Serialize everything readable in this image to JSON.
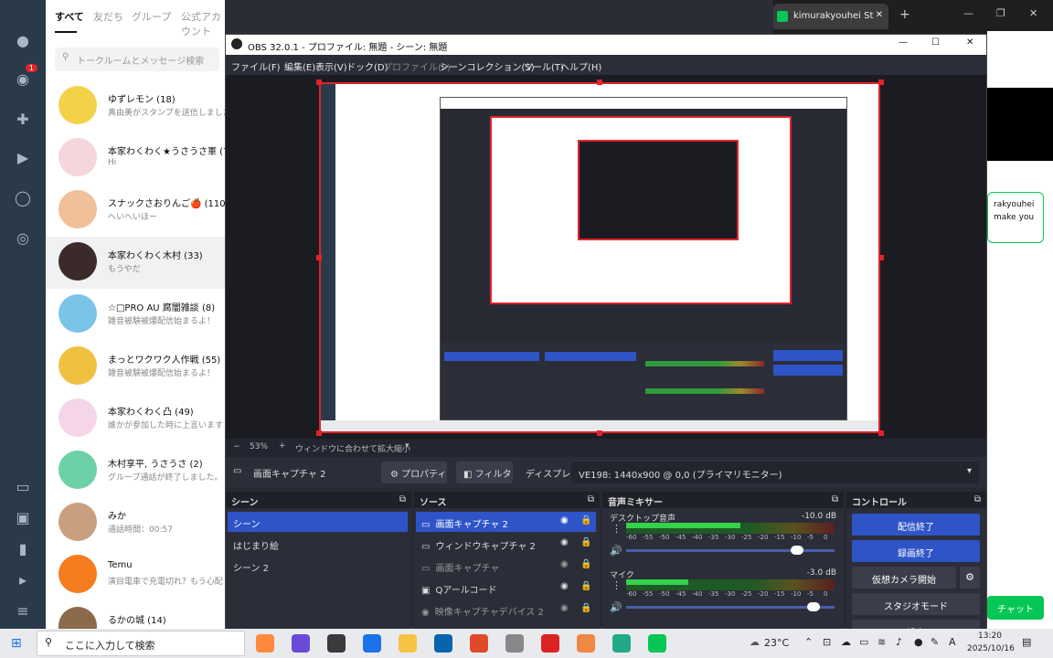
{
  "line": {
    "tabs": [
      "すべて",
      "友だち",
      "グループ",
      "公式アカウント"
    ],
    "search_placeholder": "トークルームとメッセージ検索",
    "rail_badge": "1",
    "chats": [
      {
        "name": "ゆずレモン (18)",
        "msg": "真由美がスタンプを送信しました。"
      },
      {
        "name": "本家わくわく★うさうさ軍 (79)",
        "msg": "Hi"
      },
      {
        "name": "スナックさおりんご🍎 (110)",
        "msg": "へいへいほー"
      },
      {
        "name": "本家わくわく木村 (33)",
        "msg": "もうやだ"
      },
      {
        "name": "☆□PRO AU 腐闇雑談 (8)",
        "msg": "雑音被験被爆配信始まるよ！"
      },
      {
        "name": "まっとワクワク人作戦 (55)",
        "msg": "雑音被験被爆配信始まるよ！"
      },
      {
        "name": "本家わくわく凸 (49)",
        "msg": "誰かが参加した時に上言います"
      },
      {
        "name": "木村享平, うさうさ (2)",
        "msg": "グループ通話が終了しました。"
      },
      {
        "name": "みか",
        "msg": "通話時間：00:57"
      },
      {
        "name": "Temu",
        "msg": "演目電車で充電切れ？もう心配"
      },
      {
        "name": "るかの城 (14)",
        "msg": ""
      }
    ]
  },
  "chrome": {
    "tab_title": "kimurakyouhei St",
    "bubble_line1": "rakyouhei",
    "bubble_line2": "make you",
    "chat_button": "チャット"
  },
  "obs": {
    "title": "OBS 32.0.1 - プロファイル: 無題 - シーン: 無題",
    "menu": [
      "ファイル(F)",
      "編集(E)",
      "表示(V)",
      "ドック(D)",
      "プロファイル(P)",
      "シーンコレクション(S)",
      "ツール(T)",
      "ヘルプ(H)"
    ],
    "zoom": "53%",
    "fit_label": "ウィンドウに合わせて拡大縮小",
    "source_name": "画面キャプチャ 2",
    "properties": "プロパティ",
    "filters": "フィルタ",
    "display_label": "ディスプレイ",
    "display_value": "VE198: 1440x900 @ 0,0 (プライマリモニター)",
    "scenes_title": "シーン",
    "scenes": [
      "シーン",
      "はじまり絵",
      "シーン 2"
    ],
    "sources_title": "ソース",
    "sources": [
      "画面キャプチャ 2",
      "ウィンドウキャプチャ 2",
      "画面キャプチャ",
      "Qアールコード",
      "映像キャプチャデバイス 2"
    ],
    "mixer_title": "音声ミキサー",
    "mixer": [
      {
        "name": "デスクトップ音声",
        "db": "-10.0 dB",
        "level": 0.55,
        "vol": 0.82
      },
      {
        "name": "マイク",
        "db": "-3.0 dB",
        "level": 0.3,
        "vol": 0.9
      }
    ],
    "mixer_ticks": [
      "-60",
      "-55",
      "-50",
      "-45",
      "-40",
      "-35",
      "-30",
      "-25",
      "-20",
      "-15",
      "-10",
      "-5",
      "0"
    ],
    "controls_title": "コントロール",
    "controls": [
      "配信終了",
      "録画終了",
      "仮想カメラ開始",
      "スタジオモード",
      "設定"
    ]
  },
  "taskbar": {
    "search": "ここに入力して検索",
    "temp": "23°C",
    "time": "13:20",
    "date": "2025/10/16"
  },
  "colors": {
    "accent": "#2f54c7",
    "red": "#e0242a",
    "line_green": "#06c755"
  }
}
